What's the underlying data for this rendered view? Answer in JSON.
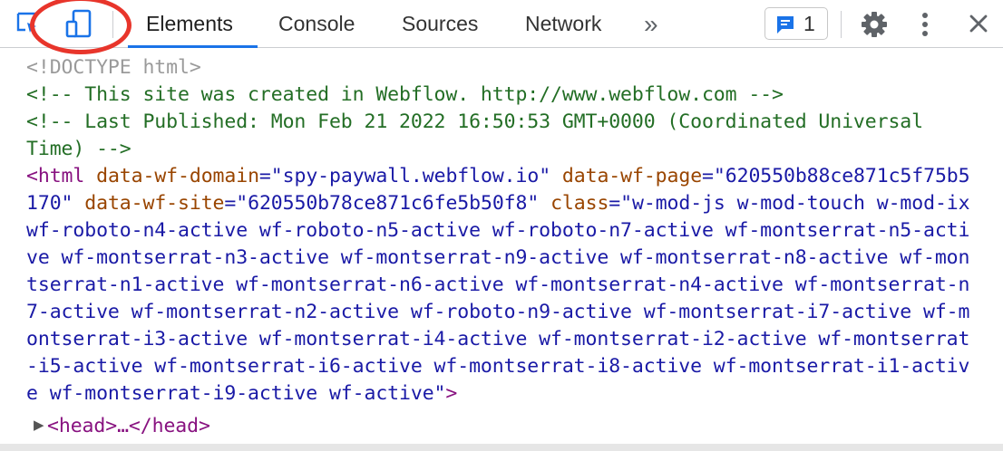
{
  "tabs": [
    {
      "label": "Elements"
    },
    {
      "label": "Console"
    },
    {
      "label": "Sources"
    },
    {
      "label": "Network"
    }
  ],
  "more_tabs": "»",
  "issues_count": "1",
  "icons": {
    "inspect": "inspect-element-icon",
    "device": "device-toolbar-icon",
    "issues": "issues-chat-icon",
    "settings": "gear-icon",
    "menu": "kebab-menu-icon",
    "close": "close-icon"
  },
  "colors": {
    "accent": "#1a73e8",
    "annotation_circle": "#e8352b",
    "comment": "#236e25",
    "tag": "#881280",
    "attribute": "#994500",
    "value": "#1a1aa6"
  },
  "dom": {
    "doctype": "<!DOCTYPE html>",
    "comment1": "<!-- This site was created in Webflow. http://www.webflow.com -->",
    "comment2_line1": "<!-- Last Published: Mon Feb 21 2022 16:50:53 GMT+0000 (Coordinated Universal",
    "comment2_line2": "Time) -->",
    "html_open": "<html",
    "attr1_name": "data-wf-domain",
    "attr1_value": "\"spy-paywall.webflow.io\"",
    "attr2_name": "data-wf-page",
    "attr2_value_part1": "\"620550b88ce871c5f75b5",
    "attr2_value_part2": "170\"",
    "attr3_name": "data-wf-site",
    "attr3_value": "\"620550b78ce871c6fe5b50f8\"",
    "attr4_name": "class",
    "class_value_start": "\"w-mod-js w-mod-touch w-mod-ix",
    "class_lines": [
      "wf-roboto-n4-active wf-roboto-n5-active wf-roboto-n7-active wf-montserrat-n5-acti",
      "ve wf-montserrat-n3-active wf-montserrat-n9-active wf-montserrat-n8-active wf-mon",
      "tserrat-n1-active wf-montserrat-n6-active wf-montserrat-n4-active wf-montserrat-n",
      "7-active wf-montserrat-n2-active wf-roboto-n9-active wf-montserrat-i7-active wf-m",
      "ontserrat-i3-active wf-montserrat-i4-active wf-montserrat-i2-active wf-montserrat",
      "-i5-active wf-montserrat-i6-active wf-montserrat-i8-active wf-montserrat-i1-activ"
    ],
    "class_value_end": "e wf-montserrat-i9-active wf-active\"",
    "html_close_bracket": ">",
    "head_node": "<head>…</head>"
  }
}
